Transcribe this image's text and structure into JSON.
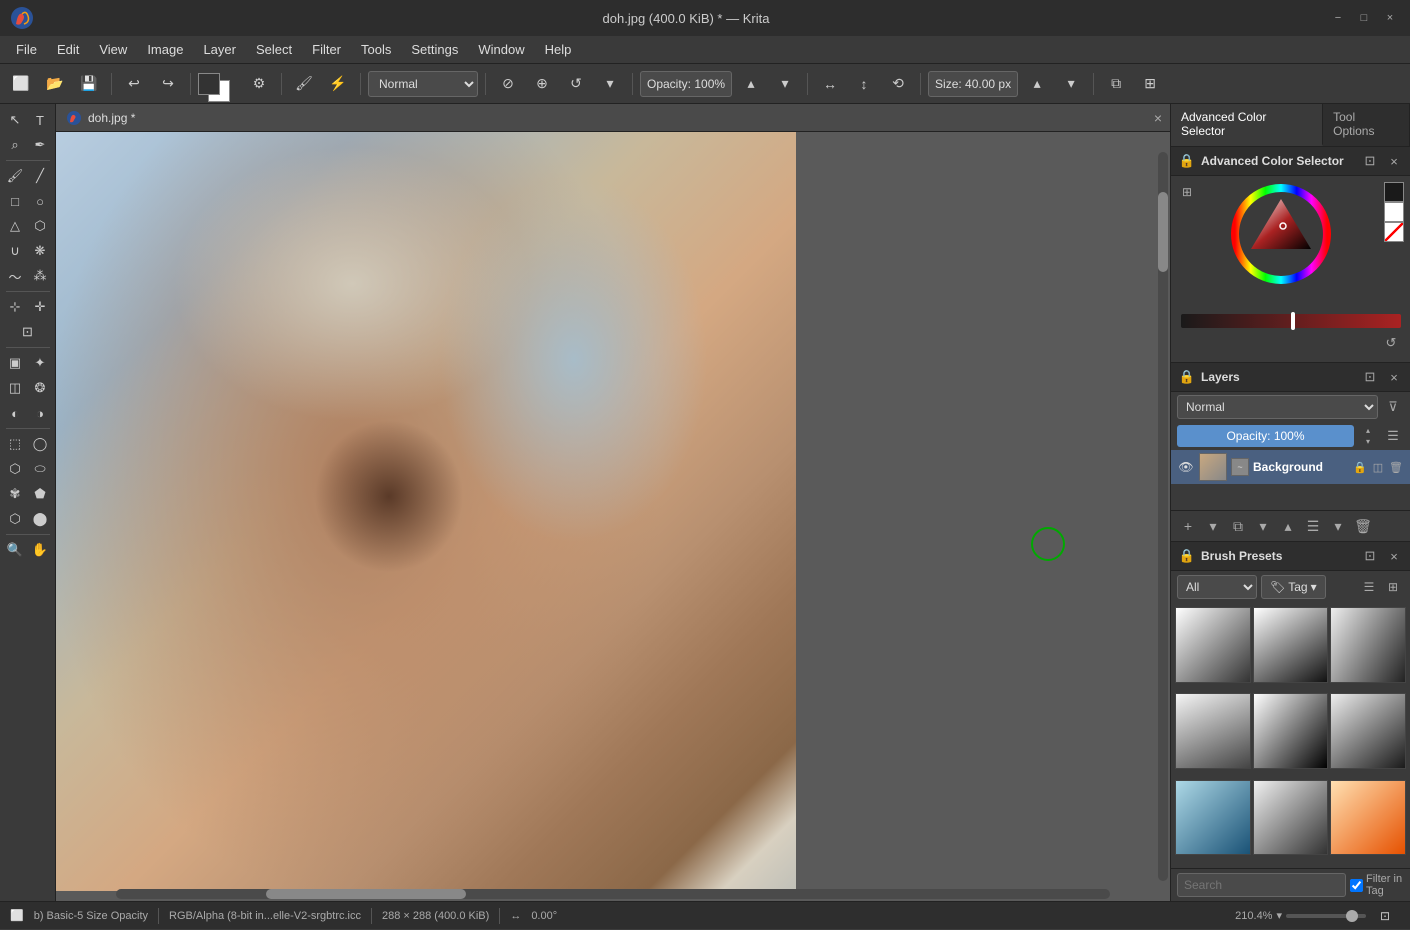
{
  "titlebar": {
    "title": "doh.jpg (400.0 KiB) * — Krita",
    "minimize": "−",
    "maximize": "□",
    "close": "×"
  },
  "menubar": {
    "items": [
      "File",
      "Edit",
      "View",
      "Image",
      "Layer",
      "Select",
      "Filter",
      "Tools",
      "Settings",
      "Window",
      "Help"
    ]
  },
  "toolbar": {
    "blend_mode": "Normal",
    "opacity_label": "Opacity: 100%",
    "size_label": "Size: 40.00 px"
  },
  "canvas": {
    "tab_title": "doh.jpg *"
  },
  "advanced_color_selector": {
    "title": "Advanced Color Selector",
    "panel_tab1": "Advanced Color Selector",
    "panel_tab2": "Tool Options"
  },
  "layers": {
    "title": "Layers",
    "blend_mode": "Normal",
    "opacity": "Opacity: 100%",
    "background_layer": "Background"
  },
  "brush_presets": {
    "title": "Brush Presets",
    "filter_all": "All",
    "tag_label": "Tag",
    "search_placeholder": "Search",
    "filter_in_tag": "Filter in Tag"
  },
  "statusbar": {
    "brush_name": "b) Basic-5 Size Opacity",
    "color_profile": "RGB/Alpha (8-bit in...elle-V2-srgbtrc.icc",
    "dimensions": "288 × 288 (400.0 KiB)",
    "rotation": "0.00°",
    "zoom": "210.4%"
  }
}
